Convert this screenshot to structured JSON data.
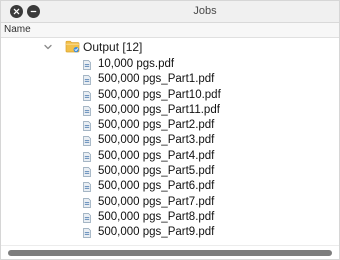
{
  "window": {
    "title": "Jobs"
  },
  "columns": {
    "name": "Name"
  },
  "folder": {
    "label": "Output [12]"
  },
  "files": [
    "10,000 pgs.pdf",
    "500,000 pgs_Part1.pdf",
    "500,000 pgs_Part10.pdf",
    "500,000 pgs_Part11.pdf",
    "500,000 pgs_Part2.pdf",
    "500,000 pgs_Part3.pdf",
    "500,000 pgs_Part4.pdf",
    "500,000 pgs_Part5.pdf",
    "500,000 pgs_Part6.pdf",
    "500,000 pgs_Part7.pdf",
    "500,000 pgs_Part8.pdf",
    "500,000 pgs_Part9.pdf"
  ],
  "icons": {
    "close": "close-icon",
    "minimize": "minimize-icon",
    "disclosure": "chevron-down-icon",
    "folder": "folder-icon",
    "file": "pdf-file-icon"
  }
}
